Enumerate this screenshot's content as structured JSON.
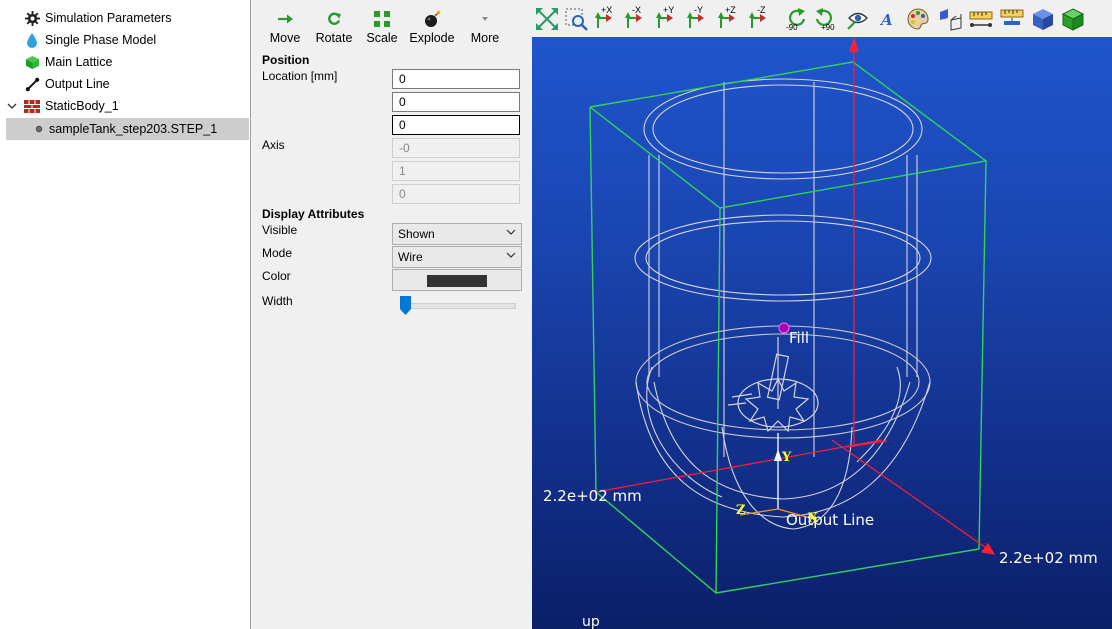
{
  "tree": {
    "items": [
      {
        "label": "Simulation Parameters",
        "icon": "gear-icon"
      },
      {
        "label": "Single Phase Model",
        "icon": "water-drop-icon"
      },
      {
        "label": "Main Lattice",
        "icon": "green-cube-icon"
      },
      {
        "label": "Output Line",
        "icon": "line-icon"
      },
      {
        "label": "StaticBody_1",
        "icon": "brick-wall-icon",
        "expanded": true
      },
      {
        "label": "sampleTank_step203.STEP_1",
        "icon": "dot-icon",
        "selected": true
      }
    ]
  },
  "toolbar": {
    "move": "Move",
    "rotate": "Rotate",
    "scale": "Scale",
    "explode": "Explode",
    "more": "More"
  },
  "position": {
    "heading": "Position",
    "location_label": "Location [mm]",
    "location": [
      "0",
      "0",
      "0"
    ],
    "axis_label": "Axis",
    "axis": [
      "-0",
      "1",
      "0"
    ]
  },
  "display": {
    "heading": "Display Attributes",
    "visible_label": "Visible",
    "visible_value": "Shown",
    "mode_label": "Mode",
    "mode_value": "Wire",
    "color_label": "Color",
    "color_value": "#333333",
    "width_label": "Width",
    "width_fraction": 0.0
  },
  "viewport_toolbar": {
    "rot_minus_label": "-90",
    "rot_plus_label": "+90",
    "axis_buttons": [
      "+X",
      "-X",
      "+Y",
      "-Y",
      "+Z",
      "-Z"
    ]
  },
  "scene": {
    "dim_left": "2.2e+02 mm",
    "dim_right": "2.2e+02 mm",
    "fill_label": "Fill",
    "output_line_label": "Output Line",
    "axis_y": "Y",
    "axis_z": "Z",
    "axis_x": "X",
    "up_label": "up",
    "colors": {
      "bbox": "#32d25a",
      "dimension": "#ff1e32",
      "wire": "#d2d2dc",
      "marker": "#aa00aa",
      "axis_label": "#ffff00"
    }
  }
}
